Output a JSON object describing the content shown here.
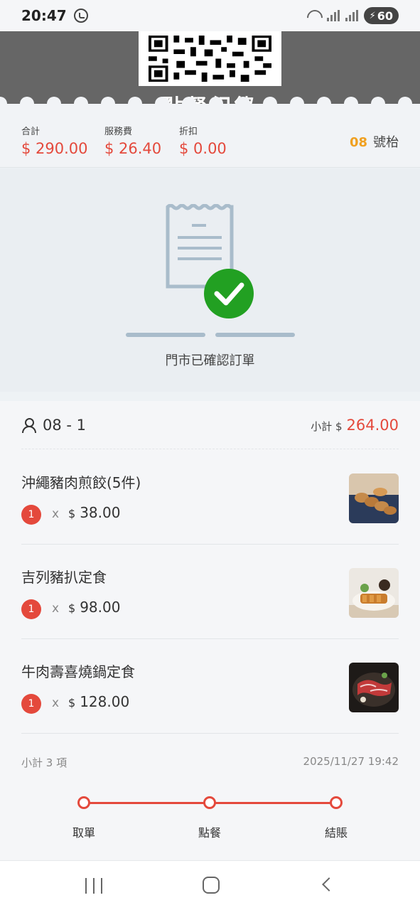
{
  "status_bar": {
    "time": "20:47",
    "battery": "60"
  },
  "header": {
    "title": "點餐紀錄"
  },
  "summary": {
    "total_label": "合計",
    "total_value": "$ 290.00",
    "service_label": "服務費",
    "service_value": "$ 26.40",
    "discount_label": "折扣",
    "discount_value": "$ 0.00",
    "table_number": "08",
    "table_suffix": "號枱"
  },
  "order_status": {
    "message": "門市已確認訂單"
  },
  "order": {
    "id": "08 - 1",
    "subtotal_label": "小計 $",
    "subtotal_value": "264.00",
    "items": [
      {
        "name": "沖繩豬肉煎餃(5件)",
        "qty": "1",
        "x": "x",
        "currency": "$",
        "price": "38.00",
        "thumb": "dumplings-photo"
      },
      {
        "name": "吉列豬扒定食",
        "qty": "1",
        "x": "x",
        "currency": "$",
        "price": "98.00",
        "thumb": "pork-cutlet-photo"
      },
      {
        "name": "牛肉壽喜燒鍋定食",
        "qty": "1",
        "x": "x",
        "currency": "$",
        "price": "128.00",
        "thumb": "sukiyaki-photo"
      }
    ],
    "item_count": "小計 3 項",
    "timestamp": "2025/11/27 19:42"
  },
  "progress": {
    "steps": [
      "取單",
      "點餐",
      "結賬"
    ]
  },
  "colors": {
    "accent": "#e4493c",
    "table_number": "#f0a020",
    "success": "#22a022"
  }
}
